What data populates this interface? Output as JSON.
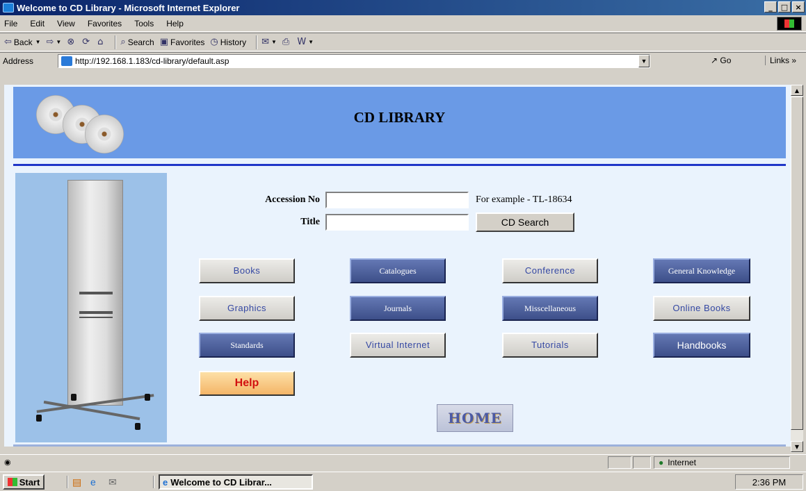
{
  "window": {
    "title": "Welcome to CD Library - Microsoft Internet Explorer",
    "controls": [
      "_",
      "□",
      "×"
    ]
  },
  "menu": [
    "File",
    "Edit",
    "View",
    "Favorites",
    "Tools",
    "Help"
  ],
  "toolbar": {
    "back": "Back",
    "search": "Search",
    "favorites": "Favorites",
    "history": "History"
  },
  "address": {
    "label": "Address",
    "url": "http://192.168.1.183/cd-library/default.asp",
    "go": "Go",
    "links": "Links"
  },
  "page": {
    "title": "CD LIBRARY",
    "accession_label": "Accession No",
    "accession_value": "",
    "example_hint": "For example - TL-18634",
    "title_label": "Title",
    "title_value": "",
    "search_button": "CD Search",
    "categories": [
      {
        "label": "Books",
        "style": "light"
      },
      {
        "label": "Catalogues",
        "style": "dark"
      },
      {
        "label": "Conference",
        "style": "light"
      },
      {
        "label": "General Knowledge",
        "style": "dark"
      },
      {
        "label": "Graphics",
        "style": "light"
      },
      {
        "label": "Journals",
        "style": "dark"
      },
      {
        "label": "Misscellaneous",
        "style": "dark"
      },
      {
        "label": "Online Books",
        "style": "light"
      },
      {
        "label": "Standards",
        "style": "dark"
      },
      {
        "label": "Virtual Internet",
        "style": "light"
      },
      {
        "label": "Tutorials",
        "style": "light"
      },
      {
        "label": "Handbooks",
        "style": "dark"
      }
    ],
    "help_button": "Help",
    "home_button": "HOME"
  },
  "status": {
    "zone": "Internet"
  },
  "taskbar": {
    "start": "Start",
    "task": "Welcome to CD Librar...",
    "clock": "2:36 PM"
  },
  "colors": {
    "banner": "#6a9ae6",
    "rule": "#1f36c8",
    "page_bg": "#eaf3fd",
    "title_bar": "#0a246a"
  }
}
